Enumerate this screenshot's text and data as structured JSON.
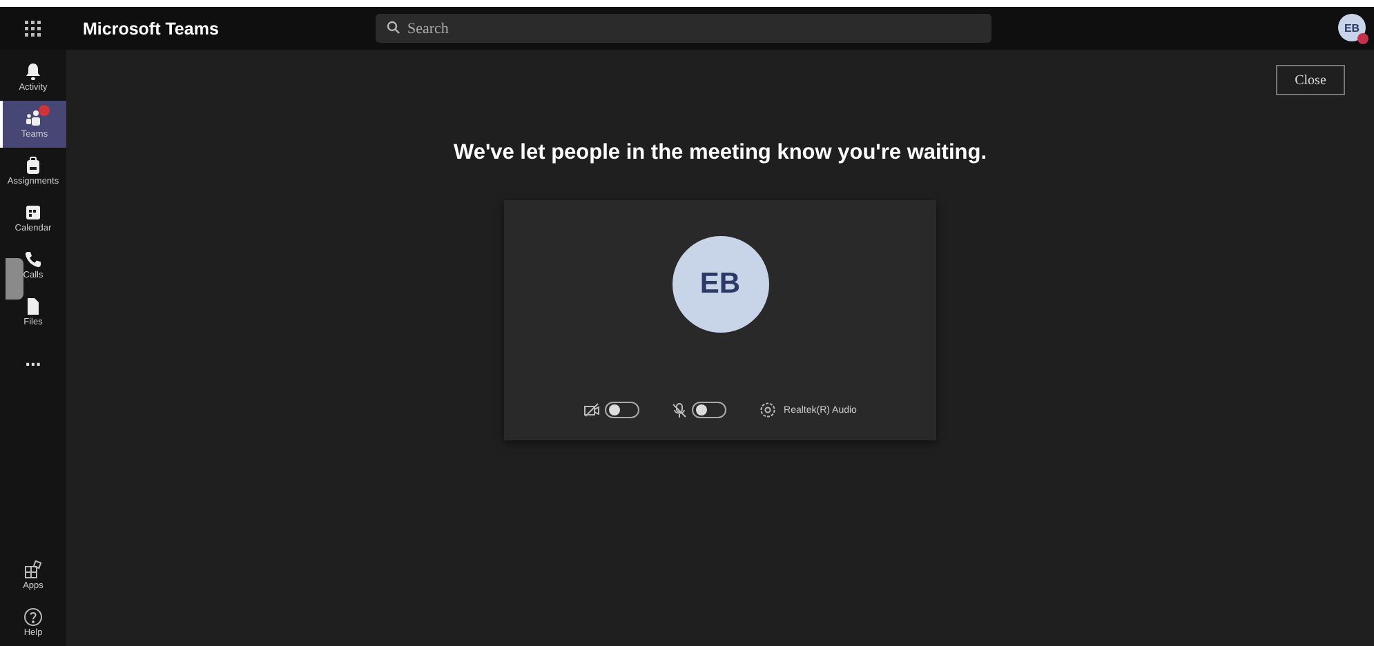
{
  "app_bar": {
    "title": "Microsoft Teams",
    "search": {
      "placeholder": "Search"
    },
    "avatar": {
      "initials": "EB"
    }
  },
  "sidebar": {
    "items": [
      {
        "label": "Activity",
        "kind": "bell",
        "selected": false,
        "badge": false
      },
      {
        "label": "Teams",
        "kind": "teams",
        "selected": true,
        "badge": true
      },
      {
        "label": "Assignments",
        "kind": "bag",
        "selected": false,
        "badge": false
      },
      {
        "label": "Calendar",
        "kind": "calendar",
        "selected": false,
        "badge": false
      },
      {
        "label": "Calls",
        "kind": "phone",
        "selected": false,
        "badge": false
      },
      {
        "label": "Files",
        "kind": "file",
        "selected": false,
        "badge": false
      },
      {
        "label": "...",
        "kind": "more",
        "selected": false,
        "badge": false
      }
    ],
    "bottom_items": [
      {
        "label": "Apps",
        "kind": "apps",
        "selected": false,
        "badge": false
      },
      {
        "label": "Help",
        "kind": "help",
        "selected": false,
        "badge": false
      }
    ]
  },
  "close_button": "Close",
  "message": "We've let people in the meeting know you're waiting.",
  "preview": {
    "initials": "EB",
    "camera": {
      "on": false
    },
    "microphone": {
      "on": false
    },
    "audio_device": "Realtek(R) Audio"
  }
}
